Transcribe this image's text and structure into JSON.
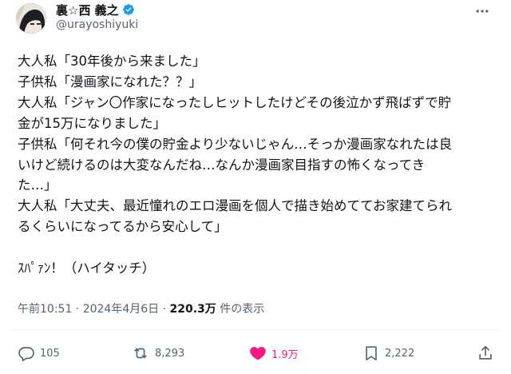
{
  "author": {
    "display_name": "裏☆西 義之",
    "handle": "@urayoshiyuki",
    "verified": true
  },
  "tweet": {
    "lines": [
      "大人私「30年後から来ました」",
      "子供私「漫画家になれた？？」",
      "大人私「ジャン〇作家になったしヒットしたけどその後泣かず飛ばずで貯",
      "金が15万になりました」",
      "子供私「何それ今の僕の貯金より少ないじゃん…そっか漫画家なれたは良",
      "いけど続けるのは大変なんだね…なんか漫画家目指すの怖くなってき",
      "た…」",
      "大人私「大丈夫、最近憧れのエロ漫画を個人で描き始めててお家建てられ",
      "るくらいになってるから安心して」",
      "",
      "ｽﾊﾟｧﾝ！（ハイタッチ）"
    ]
  },
  "meta": {
    "timestamp": "午前10:51 · 2024年4月6日 · ",
    "views_count": "220.3万",
    "views_label": " 件の表示"
  },
  "actions": {
    "replies": "105",
    "reposts": "8,293",
    "likes": "1.9万",
    "bookmarks": "2,222"
  },
  "colors": {
    "text": "#0f1419",
    "secondary": "#536471",
    "verified": "#1d9bf0",
    "like": "#f91880"
  }
}
